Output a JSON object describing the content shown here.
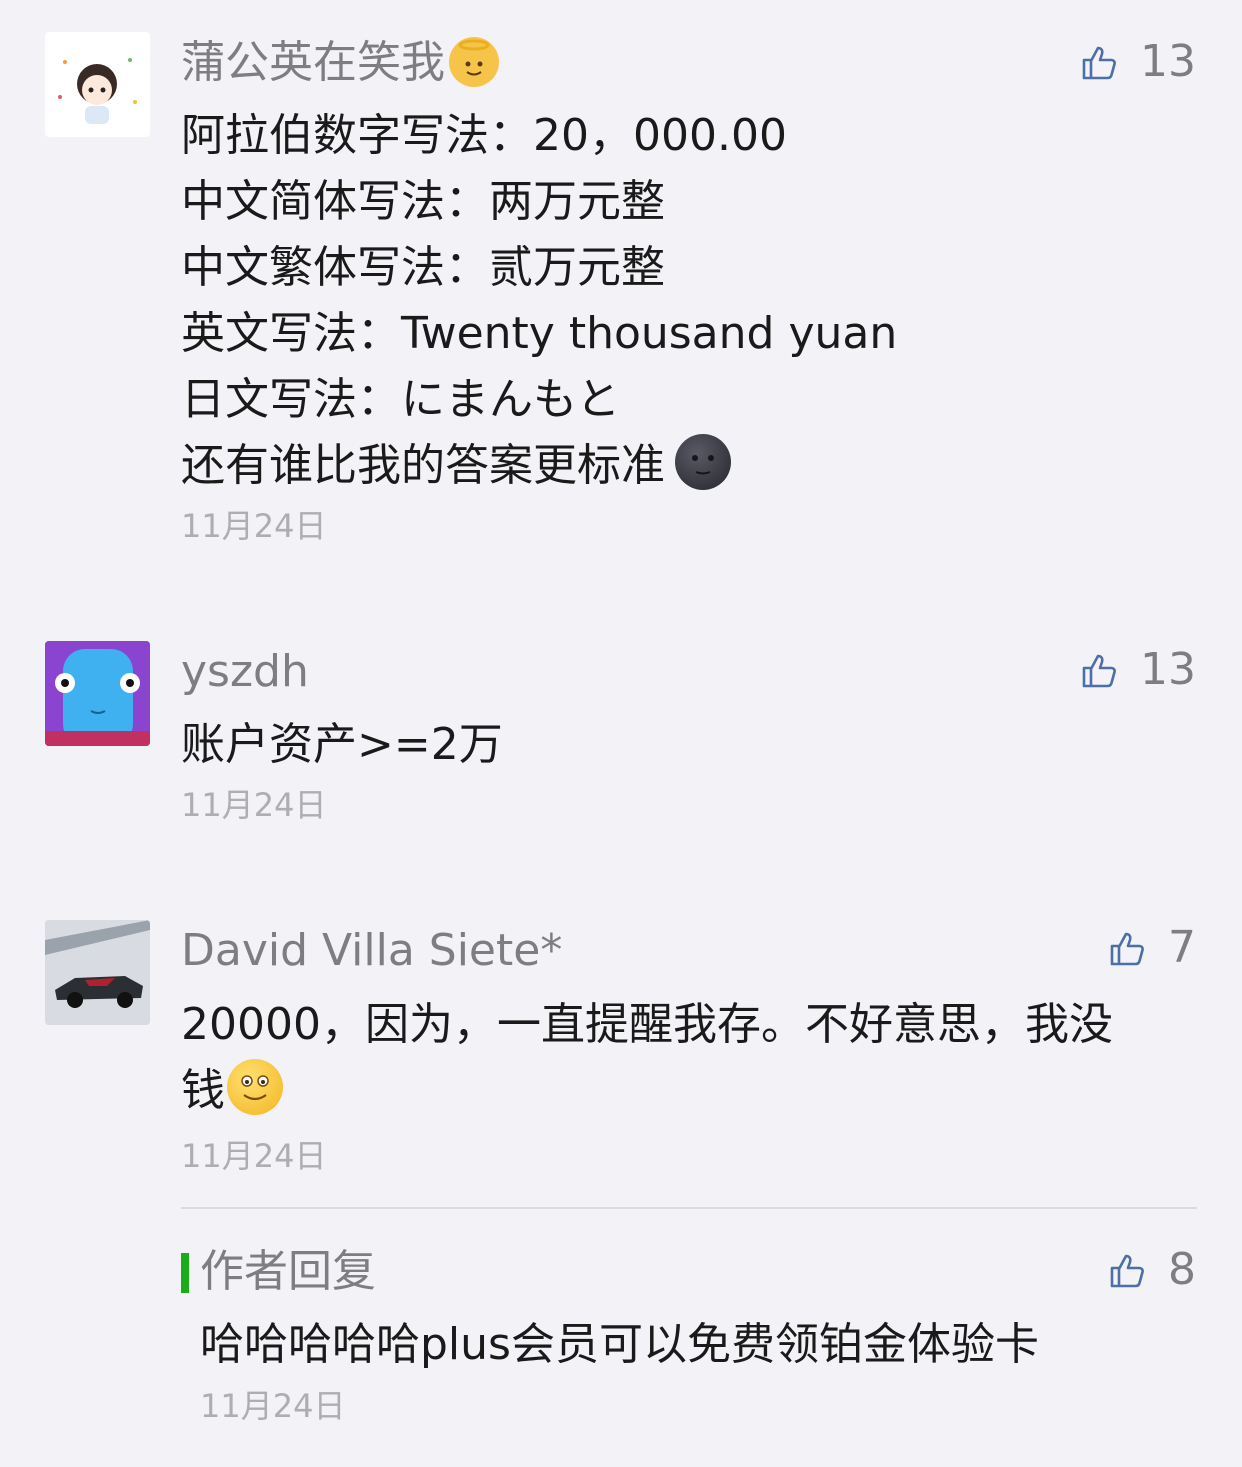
{
  "comments": [
    {
      "author": "蒲公英在笑我",
      "likes": "13",
      "lines": [
        "阿拉伯数字写法：20，000.00",
        "中文简体写法：两万元整",
        "中文繁体写法：贰万元整",
        "英文写法：Twenty thousand yuan",
        "日文写法：にまんもと",
        "还有谁比我的答案更标准"
      ],
      "date": "11月24日",
      "author_emoji": "angel-baby-emoji",
      "end_emoji": "new-moon-face-emoji"
    },
    {
      "author": "yszdh",
      "likes": "13",
      "lines": [
        "账户资产>=2万"
      ],
      "date": "11月24日"
    },
    {
      "author": "David Villa Siete*",
      "likes": "7",
      "lines": [
        "20000，因为，一直提醒我存。不好意思，我没",
        "钱"
      ],
      "date": "11月24日",
      "end_emoji": "smile-emoji"
    }
  ],
  "reply": {
    "label": "作者回复",
    "likes": "8",
    "text": "哈哈哈哈哈plus会员可以免费领铂金体验卡",
    "date": "11月24日"
  },
  "colors": {
    "background": "#f3f2f7",
    "reply_accent": "#1aad19"
  }
}
